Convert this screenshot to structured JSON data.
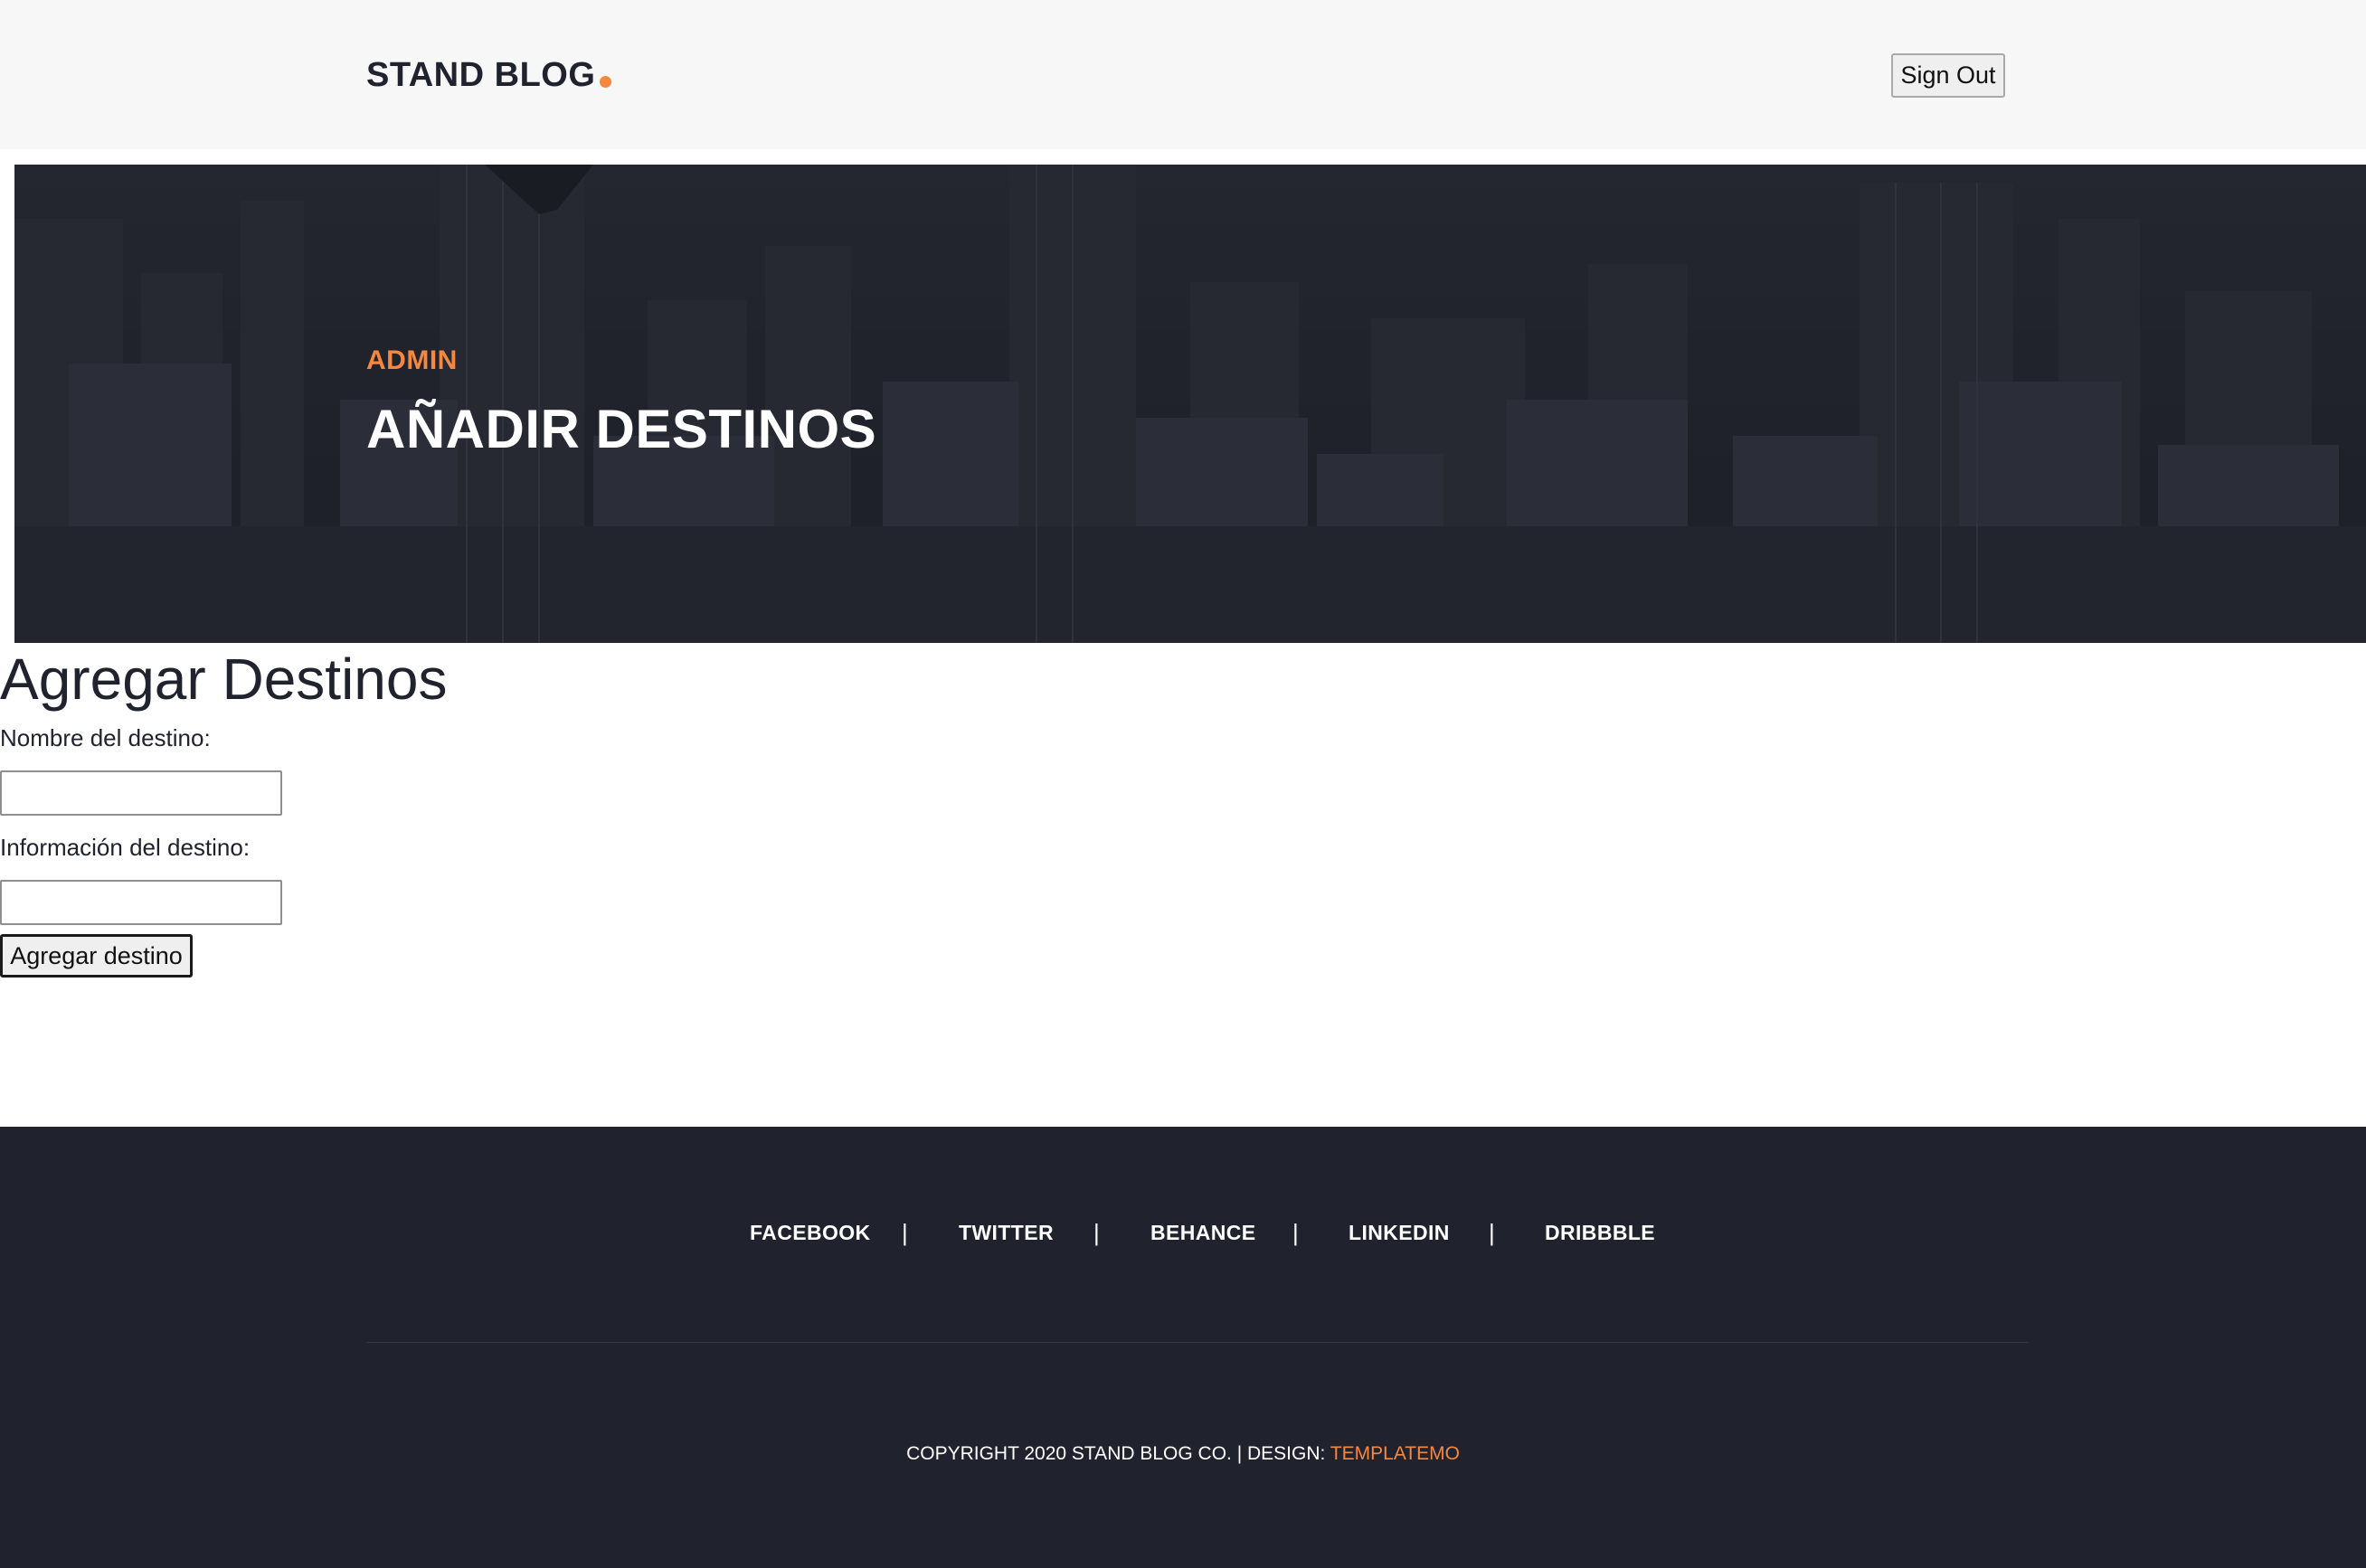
{
  "header": {
    "logo_text": "STAND BLOG",
    "signout_label": "Sign Out"
  },
  "hero": {
    "kicker": "ADMIN",
    "title": "AÑADIR DESTINOS"
  },
  "form": {
    "heading": "Agregar Destinos",
    "name_label": "Nombre del destino:",
    "name_value": "",
    "info_label": "Información del destino:",
    "info_value": "",
    "submit_label": "Agregar destino"
  },
  "footer": {
    "social_links": [
      "FACEBOOK",
      "TWITTER",
      "BEHANCE",
      "LINKEDIN",
      "DRIBBBLE"
    ],
    "separator": "|",
    "copyright_text": "COPYRIGHT 2020 STAND BLOG CO. | DESIGN: ",
    "design_link": "TEMPLATEMO"
  },
  "colors": {
    "accent": "#f48840",
    "dark": "#20232e",
    "header_bg": "#f7f7f7"
  }
}
